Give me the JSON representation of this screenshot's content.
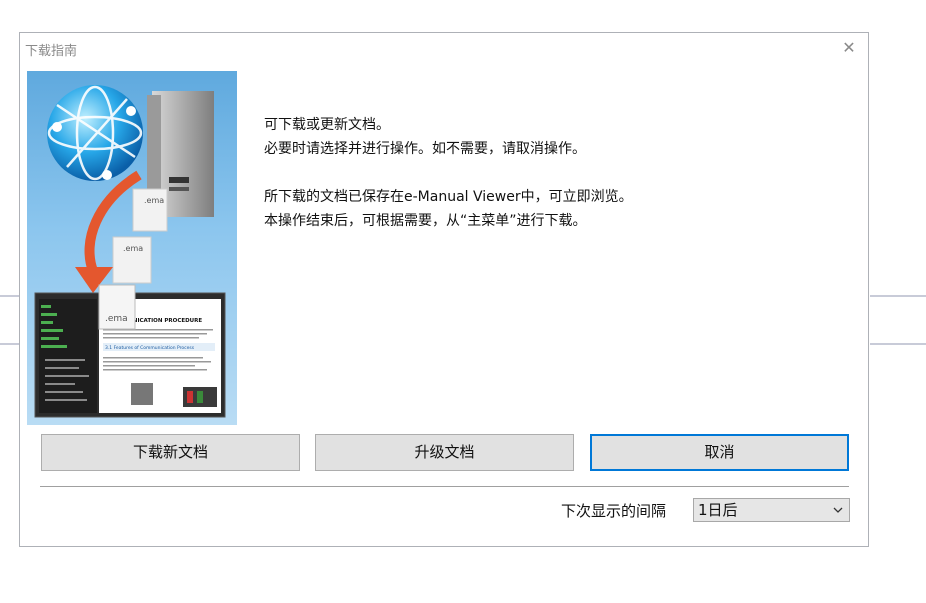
{
  "dialog": {
    "title": "下载指南",
    "close_glyph": "✕"
  },
  "message": {
    "line1": "可下载或更新文档。",
    "line2": "必要时请选择并进行操作。如不需要，请取消操作。",
    "line3": "所下载的文档已保存在e-Manual Viewer中，可立即浏览。",
    "line4": "本操作结束后，可根据需要，从“主菜单”进行下载。"
  },
  "illustration": {
    "file_ext_1": ".ema",
    "file_ext_2": ".ema",
    "file_ext_3": ".ema",
    "doc_heading": "3 COMMUNICATION PROCEDURE",
    "doc_subheading": "3.1 Features of Communication Process"
  },
  "buttons": {
    "download_new": "下载新文档",
    "upgrade": "升级文档",
    "cancel": "取消"
  },
  "interval": {
    "label": "下次显示的间隔",
    "selected": "1日后"
  },
  "colors": {
    "accent": "#0078d7",
    "button_bg": "#e1e1e1",
    "arrow": "#e4572e"
  }
}
